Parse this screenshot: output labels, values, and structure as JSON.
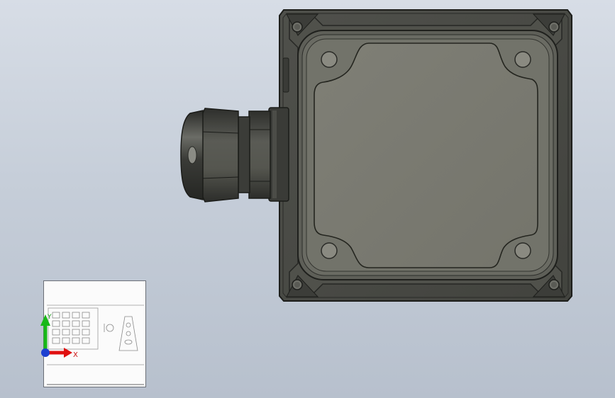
{
  "window": {
    "background_top": "#d7dde6",
    "background_bottom": "#b7c0cd"
  },
  "model": {
    "body_color": "#4a4b46",
    "lid_panel_color": "#7b7b72",
    "gland_color": "#3e3f3b",
    "components": [
      "enclosure-box",
      "lid-panel",
      "cable-gland",
      "mounting-screws"
    ]
  },
  "label_thumbnail": {
    "title": "",
    "subtitle": "",
    "footer_line1": "",
    "footer_line2": ""
  },
  "triad": {
    "x_label": "X",
    "y_label": "Y",
    "x_color": "#e01010",
    "y_color": "#18b818",
    "origin_color": "#1c3fd0"
  }
}
